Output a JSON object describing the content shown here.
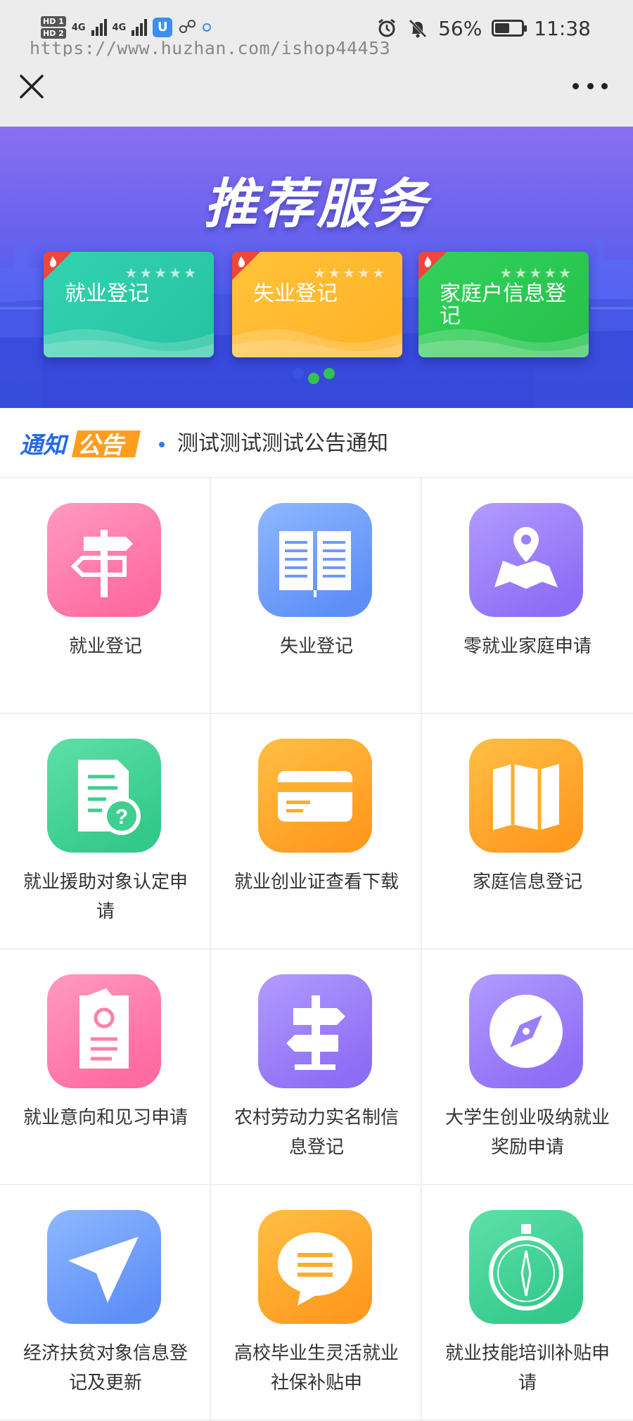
{
  "status_bar": {
    "hd1": "HD 1",
    "hd2": "HD 2",
    "net1": "4G",
    "net2": "4G",
    "app_badge": "U",
    "watermark": "https://www.huzhan.com/ishop44453",
    "battery_percent": "56%",
    "battery_level": 0.56,
    "time": "11:38"
  },
  "title_bar": {},
  "banner": {
    "title": "推荐服务",
    "cards": [
      {
        "label": "就业登记",
        "stars": "★★★★★"
      },
      {
        "label": "失业登记",
        "stars": "★★★★★"
      },
      {
        "label": "家庭户信息登记",
        "stars": "★★★★★"
      }
    ],
    "dot_colors": [
      "#3b52e0",
      "#35c24f",
      "#35c24f"
    ]
  },
  "notice": {
    "logo_text_1": "通知",
    "logo_text_2": "公告",
    "text": "测试测试测试公告通知"
  },
  "services": [
    {
      "label": "就业登记",
      "icon": "signpost-icon",
      "color": "pink"
    },
    {
      "label": "失业登记",
      "icon": "book-icon",
      "color": "blue"
    },
    {
      "label": "零就业家庭申请",
      "icon": "map-pin-icon",
      "color": "purple"
    },
    {
      "label": "就业援助对象认定申请",
      "icon": "document-question-icon",
      "color": "green"
    },
    {
      "label": "就业创业证查看下载",
      "icon": "card-icon",
      "color": "orange"
    },
    {
      "label": "家庭信息登记",
      "icon": "folded-map-icon",
      "color": "orange"
    },
    {
      "label": "就业意向和见习申请",
      "icon": "resume-icon",
      "color": "pink"
    },
    {
      "label": "农村劳动力实名制信息登记",
      "icon": "direction-sign-icon",
      "color": "purple"
    },
    {
      "label": "大学生创业吸纳就业奖励申请",
      "icon": "compass-icon",
      "color": "purple"
    },
    {
      "label": "经济扶贫对象信息登记及更新",
      "icon": "navigation-arrow-icon",
      "color": "blue"
    },
    {
      "label": "高校毕业生灵活就业社保补贴申",
      "icon": "chat-bubble-icon",
      "color": "orange"
    },
    {
      "label": "就业技能培训补贴申请",
      "icon": "stopwatch-icon",
      "color": "green"
    }
  ],
  "colors": {
    "pink": [
      "#ff9ac0",
      "#ff6b9e"
    ],
    "blue": [
      "#8fb8ff",
      "#5d8ff7"
    ],
    "purple": [
      "#b39bff",
      "#8d6df5"
    ],
    "green": [
      "#5fe0a8",
      "#33c98a"
    ],
    "orange": [
      "#ffbf45",
      "#ff9a1f"
    ]
  }
}
